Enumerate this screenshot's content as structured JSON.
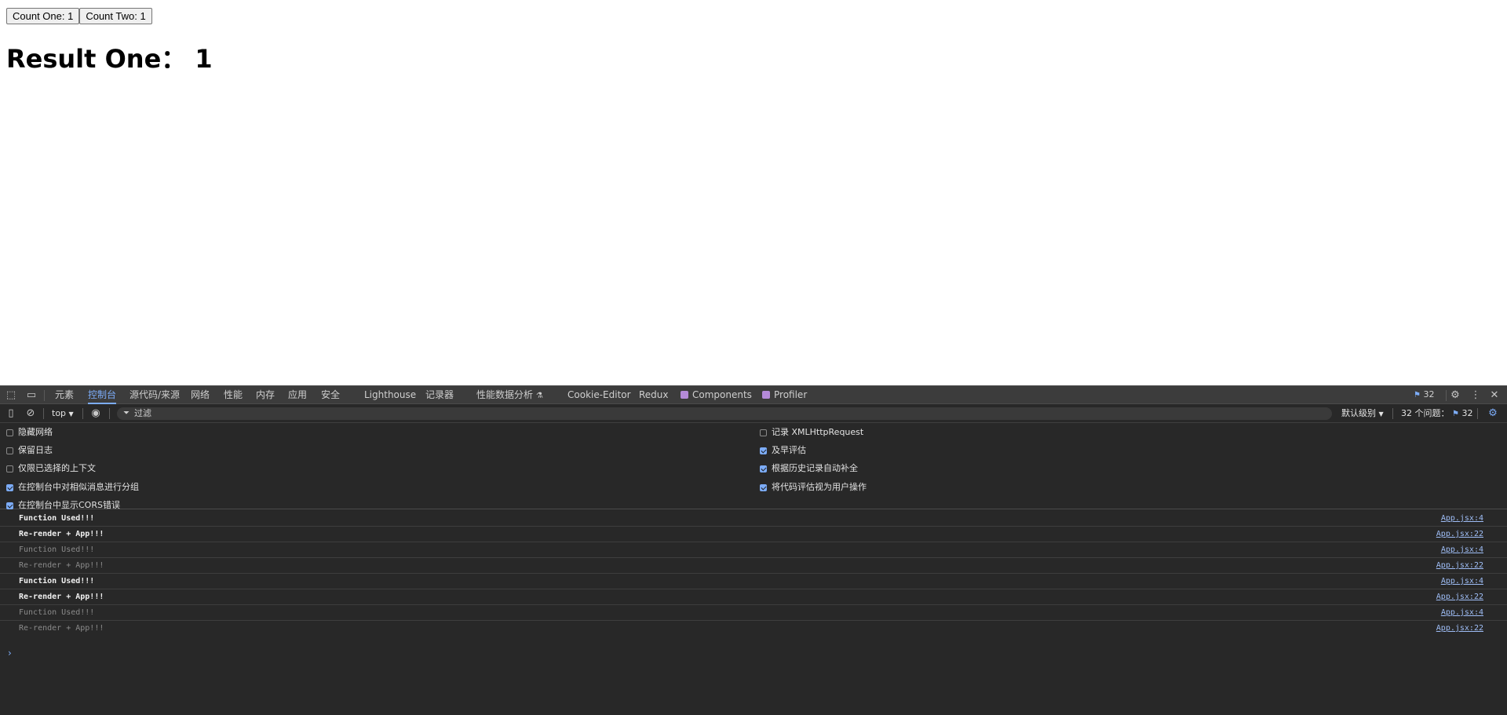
{
  "app": {
    "buttons": [
      "Count One: 1",
      "Count Two: 1"
    ],
    "result": "Result One： 1"
  },
  "devtools": {
    "tabs": [
      {
        "label": "元素",
        "active": false
      },
      {
        "label": "控制台",
        "active": true
      },
      {
        "label": "源代码/来源",
        "active": false
      },
      {
        "label": "网络",
        "active": false
      },
      {
        "label": "性能",
        "active": false
      },
      {
        "label": "内存",
        "active": false
      },
      {
        "label": "应用",
        "active": false
      },
      {
        "label": "安全",
        "active": false
      },
      {
        "label": "Lighthouse",
        "active": false
      },
      {
        "label": "记录器",
        "active": false
      },
      {
        "label": "性能数据分析",
        "active": false
      },
      {
        "label": "Cookie-Editor",
        "active": false
      },
      {
        "label": "Redux",
        "active": false
      },
      {
        "label": "Components",
        "active": false
      },
      {
        "label": "Profiler",
        "active": false
      }
    ],
    "issues_count": "32",
    "context": "top",
    "filter_placeholder": "过滤",
    "level_label": "默认级别",
    "issues_label": "32 个问题：",
    "issues_badge": "32",
    "settings_left": [
      {
        "label": "隐藏网络",
        "checked": false
      },
      {
        "label": "保留日志",
        "checked": false
      },
      {
        "label": "仅限已选择的上下文",
        "checked": false
      },
      {
        "label": "在控制台中对相似消息进行分组",
        "checked": true
      },
      {
        "label": "在控制台中显示CORS错误",
        "checked": true
      }
    ],
    "settings_right": [
      {
        "label": "记录 XMLHttpRequest",
        "checked": false
      },
      {
        "label": "及早评估",
        "checked": true
      },
      {
        "label": "根据历史记录自动补全",
        "checked": true
      },
      {
        "label": "将代码评估视为用户操作",
        "checked": true
      }
    ],
    "logs": [
      {
        "msg": "Function Used!!!",
        "src": "App.jsx:4",
        "dim": false
      },
      {
        "msg": "Re-render + App!!!",
        "src": "App.jsx:22",
        "dim": false
      },
      {
        "msg": "Function Used!!!",
        "src": "App.jsx:4",
        "dim": true
      },
      {
        "msg": "Re-render + App!!!",
        "src": "App.jsx:22",
        "dim": true
      },
      {
        "msg": "Function Used!!!",
        "src": "App.jsx:4",
        "dim": false
      },
      {
        "msg": "Re-render + App!!!",
        "src": "App.jsx:22",
        "dim": false
      },
      {
        "msg": "Function Used!!!",
        "src": "App.jsx:4",
        "dim": true
      },
      {
        "msg": "Re-render + App!!!",
        "src": "App.jsx:22",
        "dim": true
      }
    ],
    "prompt_glyph": "›"
  }
}
